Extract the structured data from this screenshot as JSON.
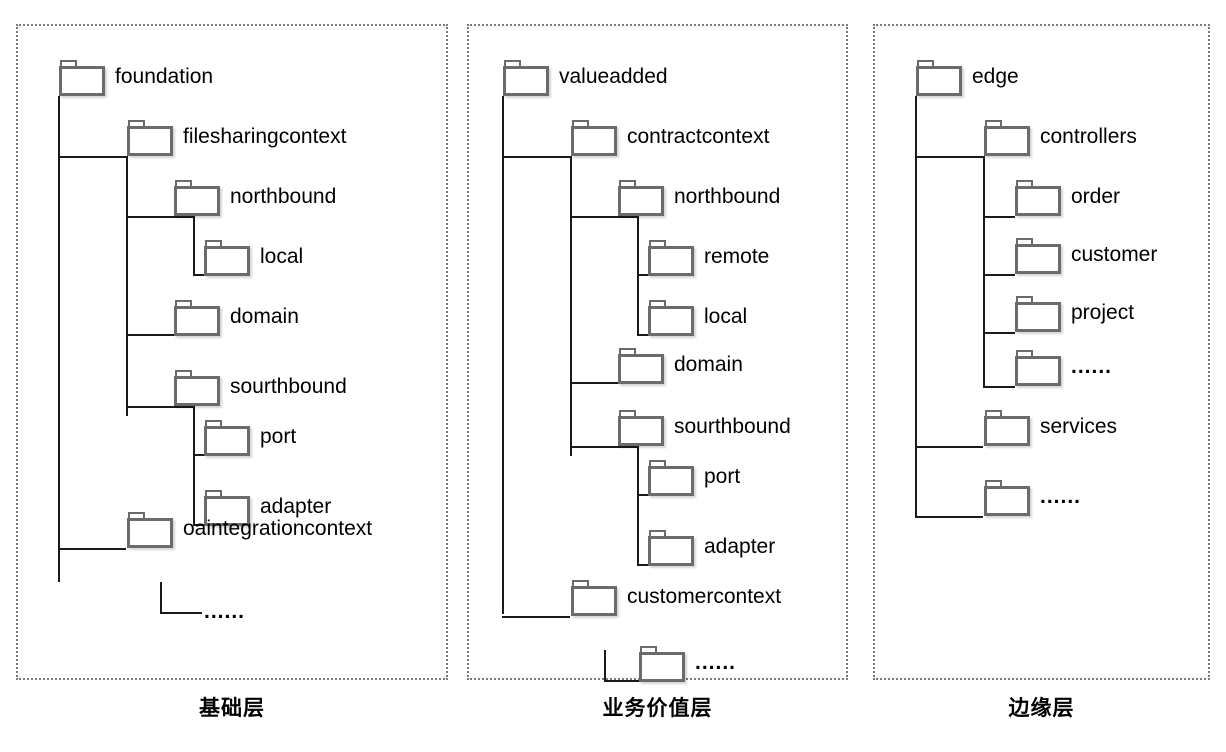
{
  "diagram": {
    "title_text": "",
    "panels": [
      {
        "id": "foundation-layer",
        "caption": "基础层",
        "root": "foundation",
        "nodes": [
          {
            "name": "foundation",
            "level": 0,
            "kind": "folder"
          },
          {
            "name": "filesharingcontext",
            "level": 1,
            "kind": "folder"
          },
          {
            "name": "northbound",
            "level": 2,
            "kind": "folder"
          },
          {
            "name": "local",
            "level": 3,
            "kind": "folder"
          },
          {
            "name": "domain",
            "level": 2,
            "kind": "folder"
          },
          {
            "name": "sourthbound",
            "level": 2,
            "kind": "folder"
          },
          {
            "name": "port",
            "level": 3,
            "kind": "folder"
          },
          {
            "name": "adapter",
            "level": 3,
            "kind": "folder"
          },
          {
            "name": "oaintegrationcontext",
            "level": 1,
            "kind": "folder"
          },
          {
            "name": "......",
            "level": 2,
            "kind": "ellipsis"
          }
        ]
      },
      {
        "id": "business-value-layer",
        "caption": "业务价值层",
        "root": "valueadded",
        "nodes": [
          {
            "name": "valueadded",
            "level": 0,
            "kind": "folder"
          },
          {
            "name": "contractcontext",
            "level": 1,
            "kind": "folder"
          },
          {
            "name": "northbound",
            "level": 2,
            "kind": "folder"
          },
          {
            "name": "remote",
            "level": 3,
            "kind": "folder"
          },
          {
            "name": "local",
            "level": 3,
            "kind": "folder"
          },
          {
            "name": "domain",
            "level": 2,
            "kind": "folder"
          },
          {
            "name": "sourthbound",
            "level": 2,
            "kind": "folder"
          },
          {
            "name": "port",
            "level": 3,
            "kind": "folder"
          },
          {
            "name": "adapter",
            "level": 3,
            "kind": "folder"
          },
          {
            "name": "customercontext",
            "level": 1,
            "kind": "folder"
          },
          {
            "name": "......",
            "level": 2,
            "kind": "folder-dots"
          }
        ]
      },
      {
        "id": "edge-layer",
        "caption": "边缘层",
        "root": "edge",
        "nodes": [
          {
            "name": "edge",
            "level": 0,
            "kind": "folder"
          },
          {
            "name": "controllers",
            "level": 1,
            "kind": "folder"
          },
          {
            "name": "order",
            "level": 2,
            "kind": "folder"
          },
          {
            "name": "customer",
            "level": 2,
            "kind": "folder"
          },
          {
            "name": "project",
            "level": 2,
            "kind": "folder"
          },
          {
            "name": "......",
            "level": 2,
            "kind": "folder-dots"
          },
          {
            "name": "services",
            "level": 1,
            "kind": "folder"
          },
          {
            "name": "......",
            "level": 1,
            "kind": "folder-dots"
          }
        ]
      }
    ],
    "colors": {
      "panel_border": "#7a7a7a",
      "folder_border": "#6b6b6b",
      "folder_fill": "#ffffff",
      "connector": "#1a1a1a",
      "text": "#000000",
      "background": "#ffffff"
    }
  }
}
